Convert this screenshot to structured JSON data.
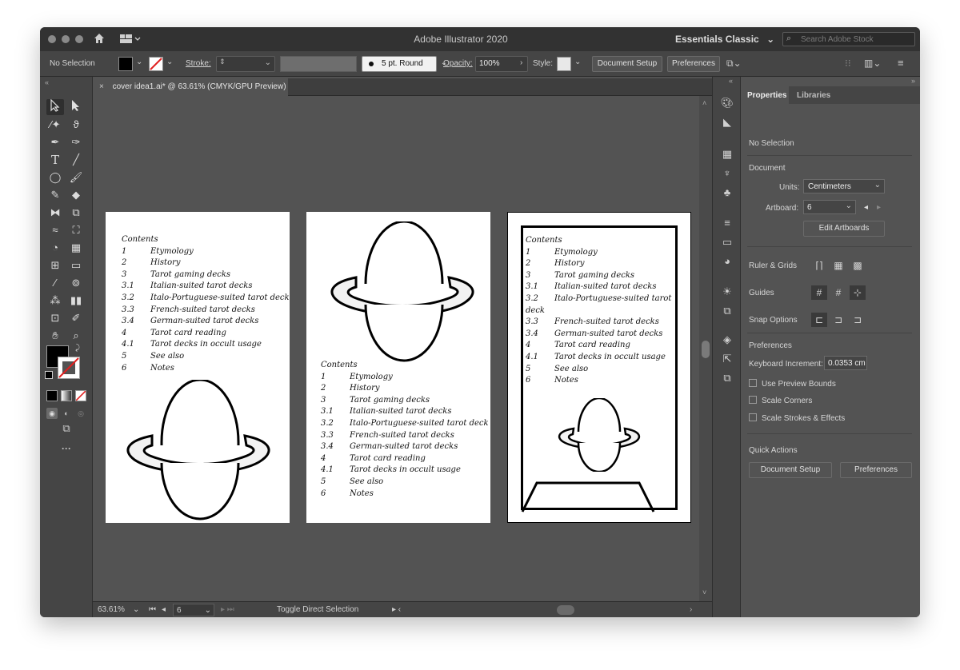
{
  "window": {
    "title": "Adobe Illustrator 2020",
    "workspace": "Essentials Classic",
    "search_placeholder": "Search Adobe Stock"
  },
  "control_bar": {
    "selection_label": "No Selection",
    "stroke_label": "Stroke:",
    "brush_label": "5 pt. Round",
    "opacity_label": "Opacity:",
    "opacity_value": "100%",
    "style_label": "Style:",
    "document_setup": "Document Setup",
    "preferences": "Preferences"
  },
  "document_tab": {
    "title": "cover idea1.ai* @ 63.61% (CMYK/GPU Preview)"
  },
  "toc": {
    "heading": "Contents",
    "items": [
      {
        "num": "1",
        "label": "Etymology"
      },
      {
        "num": "2",
        "label": "History"
      },
      {
        "num": "3",
        "label": "Tarot gaming decks"
      },
      {
        "num": "3.1",
        "label": "Italian-suited tarot decks"
      },
      {
        "num": "3.2",
        "label": "Italo-Portuguese-suited tarot deck"
      },
      {
        "num": "3.3",
        "label": "French-suited tarot decks"
      },
      {
        "num": "3.4",
        "label": "German-suited tarot decks"
      },
      {
        "num": "4",
        "label": "Tarot card reading"
      },
      {
        "num": "4.1",
        "label": "Tarot decks in occult usage"
      },
      {
        "num": "5",
        "label": "See also"
      },
      {
        "num": "6",
        "label": "Notes"
      }
    ],
    "wrapped_line_a": "Italo-Portuguese-suited tarot",
    "wrapped_line_b": "deck"
  },
  "status_bar": {
    "zoom": "63.61%",
    "artboard": "6",
    "tool_hint": "Toggle Direct Selection"
  },
  "properties_panel": {
    "tab_properties": "Properties",
    "tab_libraries": "Libraries",
    "selection": "No Selection",
    "document_section": "Document",
    "units_label": "Units:",
    "units_value": "Centimeters",
    "artboard_label": "Artboard:",
    "artboard_value": "6",
    "edit_artboards": "Edit Artboards",
    "ruler_grids": "Ruler & Grids",
    "guides": "Guides",
    "snap_options": "Snap Options",
    "preferences_section": "Preferences",
    "keyboard_increment_label": "Keyboard Increment:",
    "keyboard_increment_value": "0.0353 cm",
    "use_preview_bounds": "Use Preview Bounds",
    "scale_corners": "Scale Corners",
    "scale_strokes": "Scale Strokes & Effects",
    "quick_actions": "Quick Actions",
    "qa_document_setup": "Document Setup",
    "qa_preferences": "Preferences"
  },
  "colors": {
    "ui_bg": "#535353",
    "titlebar": "#323232",
    "panel": "#454545",
    "artboard": "#ffffff"
  }
}
